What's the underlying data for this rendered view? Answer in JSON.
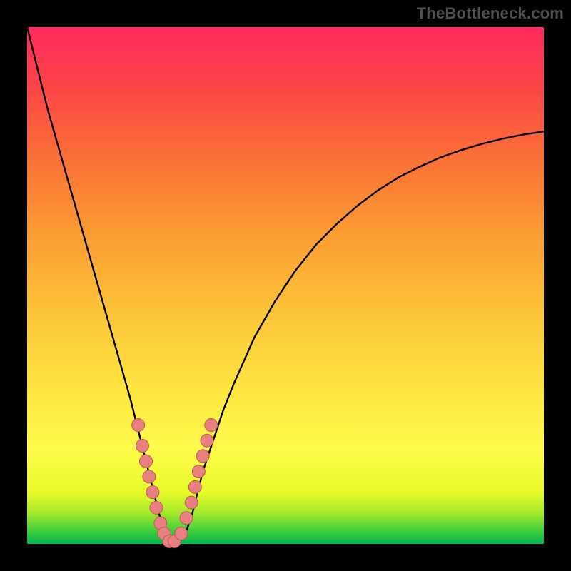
{
  "watermark": "TheBottleneck.com",
  "colors": {
    "frame": "#000000",
    "curve": "#000000",
    "marker_fill": "#e98080",
    "marker_stroke": "#c15858",
    "gradient_top": "#ff2a5f",
    "gradient_bottom": "#00b64b"
  },
  "chart_data": {
    "type": "line",
    "title": "",
    "xlabel": "",
    "ylabel": "",
    "xlim": [
      0,
      100
    ],
    "ylim": [
      0,
      100
    ],
    "grid": false,
    "series": [
      {
        "name": "bottleneck-curve",
        "x": [
          0,
          2,
          4,
          6,
          8,
          10,
          12,
          14,
          16,
          18,
          20,
          22,
          23,
          24,
          25,
          26,
          27,
          28,
          29,
          30,
          31,
          32,
          33,
          34,
          36,
          38,
          40,
          44,
          48,
          52,
          56,
          60,
          64,
          68,
          72,
          76,
          80,
          84,
          88,
          92,
          96,
          100
        ],
        "y": [
          100,
          92,
          84,
          77,
          70,
          63,
          56,
          49,
          42,
          35,
          28,
          20,
          16,
          12,
          8,
          4,
          1,
          0,
          0,
          1,
          3,
          6,
          10,
          14,
          20,
          26,
          31,
          40,
          47,
          53,
          58,
          62,
          65.5,
          68.5,
          71,
          73,
          74.8,
          76.2,
          77.4,
          78.4,
          79.2,
          79.8
        ]
      }
    ],
    "markers": {
      "name": "highlight-points",
      "x": [
        21.5,
        22.3,
        23.0,
        23.6,
        24.3,
        25.0,
        25.8,
        26.5,
        27.5,
        28.5,
        29.8,
        30.8,
        31.8,
        32.5,
        33.2,
        34.0,
        34.8,
        35.6
      ],
      "y": [
        23,
        19,
        16,
        13,
        10,
        7,
        4,
        2,
        0.5,
        0.5,
        2,
        5,
        8,
        11,
        14,
        17,
        20,
        23
      ],
      "r": 9
    }
  }
}
